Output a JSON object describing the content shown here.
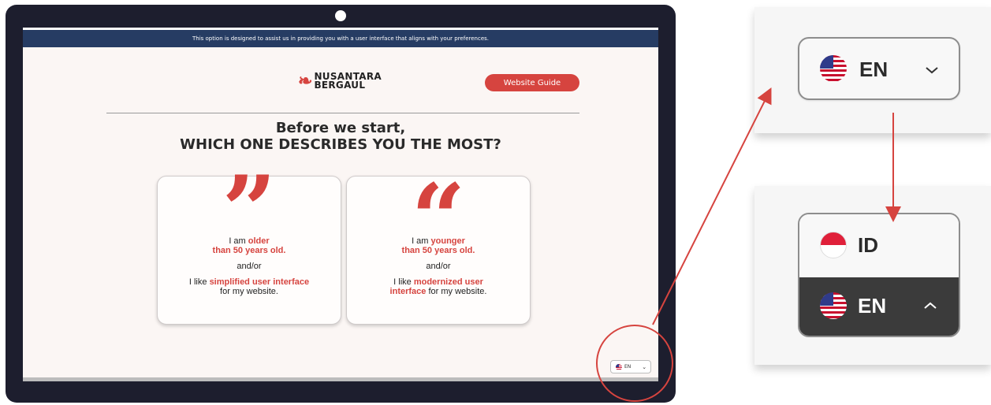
{
  "banner": {
    "text": "This option is designed to assist us in providing you with a user interface that aligns with your preferences."
  },
  "logo": {
    "mark": "❧",
    "line1": "NUSANTARA",
    "line2": "BERGAUL"
  },
  "header": {
    "guide_button": "Website Guide"
  },
  "question": {
    "line1": "Before we start,",
    "line2": "WHICH ONE DESCRIBES YOU THE MOST?"
  },
  "options": [
    {
      "quote": "”",
      "t1": "I am ",
      "t1_red": "older",
      "t2_red": "than 50 years old.",
      "andor": "and/or",
      "t3": "I like ",
      "t3_red": "simplified user interface",
      "t4": "for my website."
    },
    {
      "quote": "“",
      "t1": "I am ",
      "t1_red": "younger",
      "t2_red": "than 50 years old.",
      "andor": "and/or",
      "t3": "I like ",
      "t3_red": "modernized user",
      "t4_red": "interface",
      "t4": " for my website."
    }
  ],
  "language": {
    "current": "EN",
    "options": [
      "ID",
      "EN"
    ],
    "flag_icons": [
      "us-flag-icon",
      "indonesia-flag-icon"
    ]
  },
  "colors": {
    "accent": "#d6443f",
    "banner": "#263c63",
    "frame": "#1d1e2e",
    "selected_option": "#3b3b3b"
  }
}
